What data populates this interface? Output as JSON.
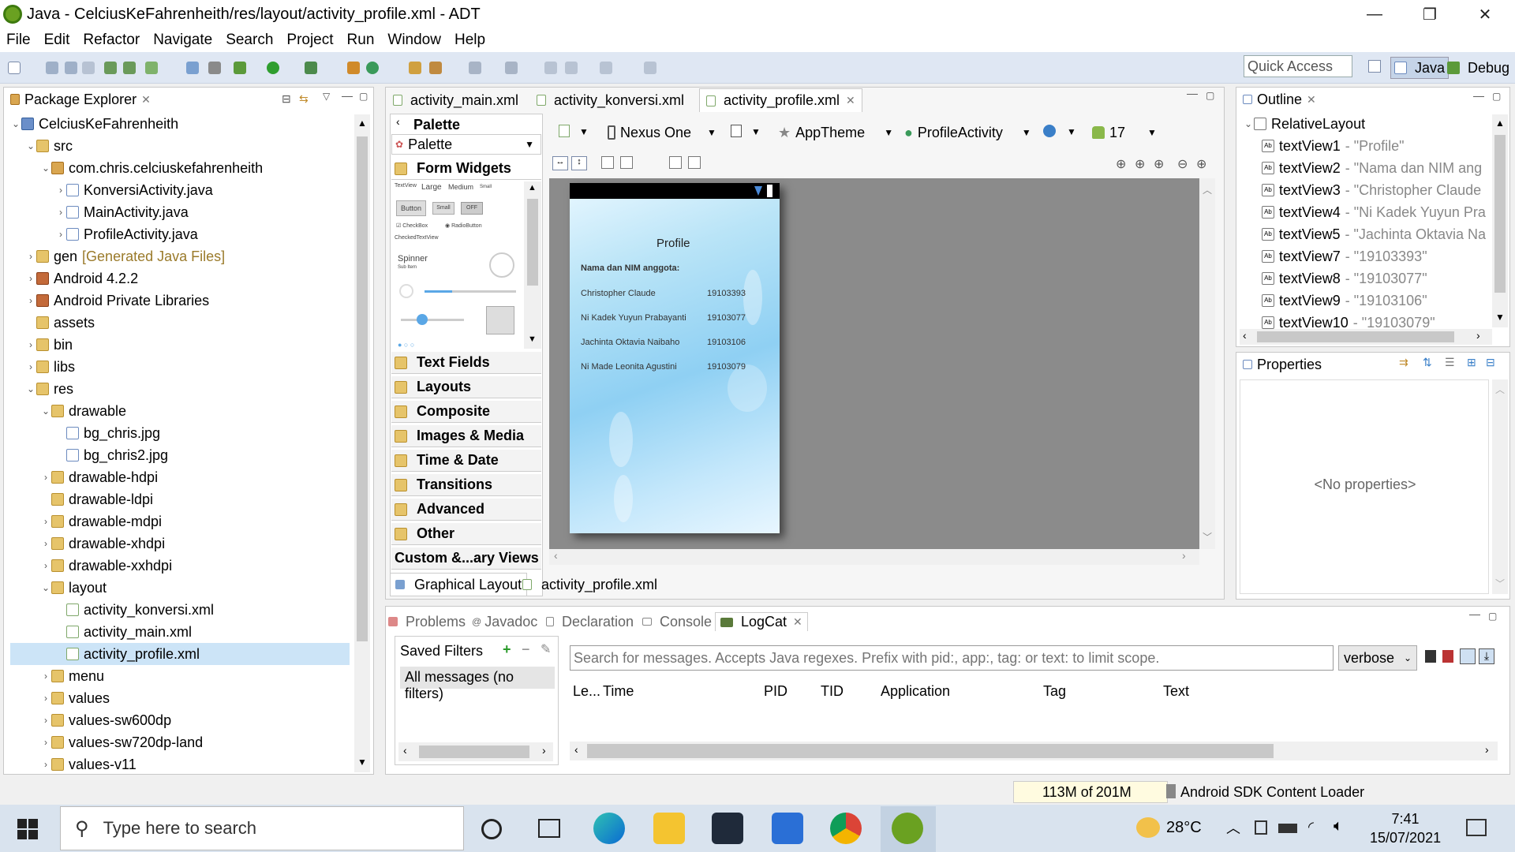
{
  "window": {
    "title": "Java - CelciusKeFahrenheith/res/layout/activity_profile.xml - ADT",
    "minimize": "—",
    "maximize": "❐",
    "close": "✕"
  },
  "menu": [
    "File",
    "Edit",
    "Refactor",
    "Navigate",
    "Search",
    "Project",
    "Run",
    "Window",
    "Help"
  ],
  "toolbar": {
    "quick_access": "Quick Access",
    "perspectives": [
      "Java",
      "Debug"
    ]
  },
  "package_explorer": {
    "title": "Package Explorer",
    "items": [
      {
        "label": "CelciusKeFahrenheith",
        "indent": 0,
        "tw": "⌄",
        "icon": "proj"
      },
      {
        "label": "src",
        "indent": 1,
        "tw": "⌄",
        "icon": "folder"
      },
      {
        "label": "com.chris.celciuskefahrenheith",
        "indent": 2,
        "tw": "⌄",
        "icon": "pkg"
      },
      {
        "label": "KonversiActivity.java",
        "indent": 3,
        "tw": "›",
        "icon": "jfile"
      },
      {
        "label": "MainActivity.java",
        "indent": 3,
        "tw": "›",
        "icon": "jfile"
      },
      {
        "label": "ProfileActivity.java",
        "indent": 3,
        "tw": "›",
        "icon": "jfile"
      },
      {
        "label": "gen",
        "extra": "[Generated Java Files]",
        "indent": 1,
        "tw": "›",
        "icon": "folder"
      },
      {
        "label": "Android 4.2.2",
        "indent": 1,
        "tw": "›",
        "icon": "jar"
      },
      {
        "label": "Android Private Libraries",
        "indent": 1,
        "tw": "›",
        "icon": "jar"
      },
      {
        "label": "assets",
        "indent": 1,
        "tw": "",
        "icon": "folder"
      },
      {
        "label": "bin",
        "indent": 1,
        "tw": "›",
        "icon": "folder"
      },
      {
        "label": "libs",
        "indent": 1,
        "tw": "›",
        "icon": "folder"
      },
      {
        "label": "res",
        "indent": 1,
        "tw": "⌄",
        "icon": "folder"
      },
      {
        "label": "drawable",
        "indent": 2,
        "tw": "⌄",
        "icon": "folder"
      },
      {
        "label": "bg_chris.jpg",
        "indent": 3,
        "tw": "",
        "icon": "jfile"
      },
      {
        "label": "bg_chris2.jpg",
        "indent": 3,
        "tw": "",
        "icon": "jfile"
      },
      {
        "label": "drawable-hdpi",
        "indent": 2,
        "tw": "›",
        "icon": "folder"
      },
      {
        "label": "drawable-ldpi",
        "indent": 2,
        "tw": "",
        "icon": "folder"
      },
      {
        "label": "drawable-mdpi",
        "indent": 2,
        "tw": "›",
        "icon": "folder"
      },
      {
        "label": "drawable-xhdpi",
        "indent": 2,
        "tw": "›",
        "icon": "folder"
      },
      {
        "label": "drawable-xxhdpi",
        "indent": 2,
        "tw": "›",
        "icon": "folder"
      },
      {
        "label": "layout",
        "indent": 2,
        "tw": "⌄",
        "icon": "folder"
      },
      {
        "label": "activity_konversi.xml",
        "indent": 3,
        "tw": "",
        "icon": "xfile"
      },
      {
        "label": "activity_main.xml",
        "indent": 3,
        "tw": "",
        "icon": "xfile"
      },
      {
        "label": "activity_profile.xml",
        "indent": 3,
        "tw": "",
        "icon": "xfile",
        "selected": true
      },
      {
        "label": "menu",
        "indent": 2,
        "tw": "›",
        "icon": "folder"
      },
      {
        "label": "values",
        "indent": 2,
        "tw": "›",
        "icon": "folder"
      },
      {
        "label": "values-sw600dp",
        "indent": 2,
        "tw": "›",
        "icon": "folder"
      },
      {
        "label": "values-sw720dp-land",
        "indent": 2,
        "tw": "›",
        "icon": "folder"
      },
      {
        "label": "values-v11",
        "indent": 2,
        "tw": "›",
        "icon": "folder"
      }
    ]
  },
  "editor": {
    "tabs": [
      "activity_main.xml",
      "activity_konversi.xml",
      "activity_profile.xml"
    ],
    "active_tab": 2,
    "bottom_tabs": [
      "Graphical Layout",
      "activity_profile.xml"
    ],
    "config": {
      "device": "Nexus One",
      "theme": "AppTheme",
      "activity": "ProfileActivity",
      "api": "17"
    }
  },
  "palette": {
    "title": "Palette",
    "dropdown": "Palette",
    "open_category": "Form Widgets",
    "widget_preview": {
      "textview": "TextView",
      "large": "Large",
      "medium": "Medium",
      "small": "Small",
      "button": "Button",
      "small_btn": "Small",
      "off": "OFF",
      "checkbox": "CheckBox",
      "radio": "RadioButton",
      "checked": "CheckedTextView",
      "spinner": "Spinner",
      "subitem": "Sub Item"
    },
    "categories": [
      "Text Fields",
      "Layouts",
      "Composite",
      "Images & Media",
      "Time & Date",
      "Transitions",
      "Advanced",
      "Other",
      "Custom &...ary Views"
    ]
  },
  "device_screen": {
    "title": "Profile",
    "heading": "Nama dan NIM anggota:",
    "members": [
      {
        "name": "Christopher Claude",
        "nim": "19103393"
      },
      {
        "name": "Ni Kadek Yuyun Prabayanti",
        "nim": "19103077"
      },
      {
        "name": "Jachinta Oktavia Naibaho",
        "nim": "19103106"
      },
      {
        "name": "Ni Made Leonita Agustini",
        "nim": "19103079"
      }
    ]
  },
  "outline": {
    "title": "Outline",
    "root": "RelativeLayout",
    "items": [
      {
        "id": "textView1",
        "val": "- \"Profile\""
      },
      {
        "id": "textView2",
        "val": "- \"Nama dan NIM ang"
      },
      {
        "id": "textView3",
        "val": "- \"Christopher Claude"
      },
      {
        "id": "textView4",
        "val": "- \"Ni Kadek Yuyun Pra"
      },
      {
        "id": "textView5",
        "val": "- \"Jachinta Oktavia Na"
      },
      {
        "id": "textView7",
        "val": "- \"19103393\""
      },
      {
        "id": "textView8",
        "val": "- \"19103077\""
      },
      {
        "id": "textView9",
        "val": "- \"19103106\""
      },
      {
        "id": "textView10",
        "val": "- \"19103079\""
      }
    ]
  },
  "properties": {
    "title": "Properties",
    "empty": "<No properties>"
  },
  "bottom_panel": {
    "tabs": [
      "Problems",
      "Javadoc",
      "Declaration",
      "Console",
      "LogCat"
    ],
    "active": "LogCat",
    "saved_filters": "Saved Filters",
    "all_messages": "All messages (no filters)",
    "search_placeholder": "Search for messages. Accepts Java regexes. Prefix with pid:, app:, tag: or text: to limit scope.",
    "level": "verbose",
    "columns": [
      "Le...",
      "Time",
      "PID",
      "TID",
      "Application",
      "Tag",
      "Text"
    ]
  },
  "status": {
    "memory_used": "113M of",
    "memory_total": "201M",
    "loader": "Android SDK Content Loader"
  },
  "taskbar": {
    "search": "Type here to search",
    "temp": "28°C",
    "time": "7:41",
    "date": "15/07/2021"
  }
}
